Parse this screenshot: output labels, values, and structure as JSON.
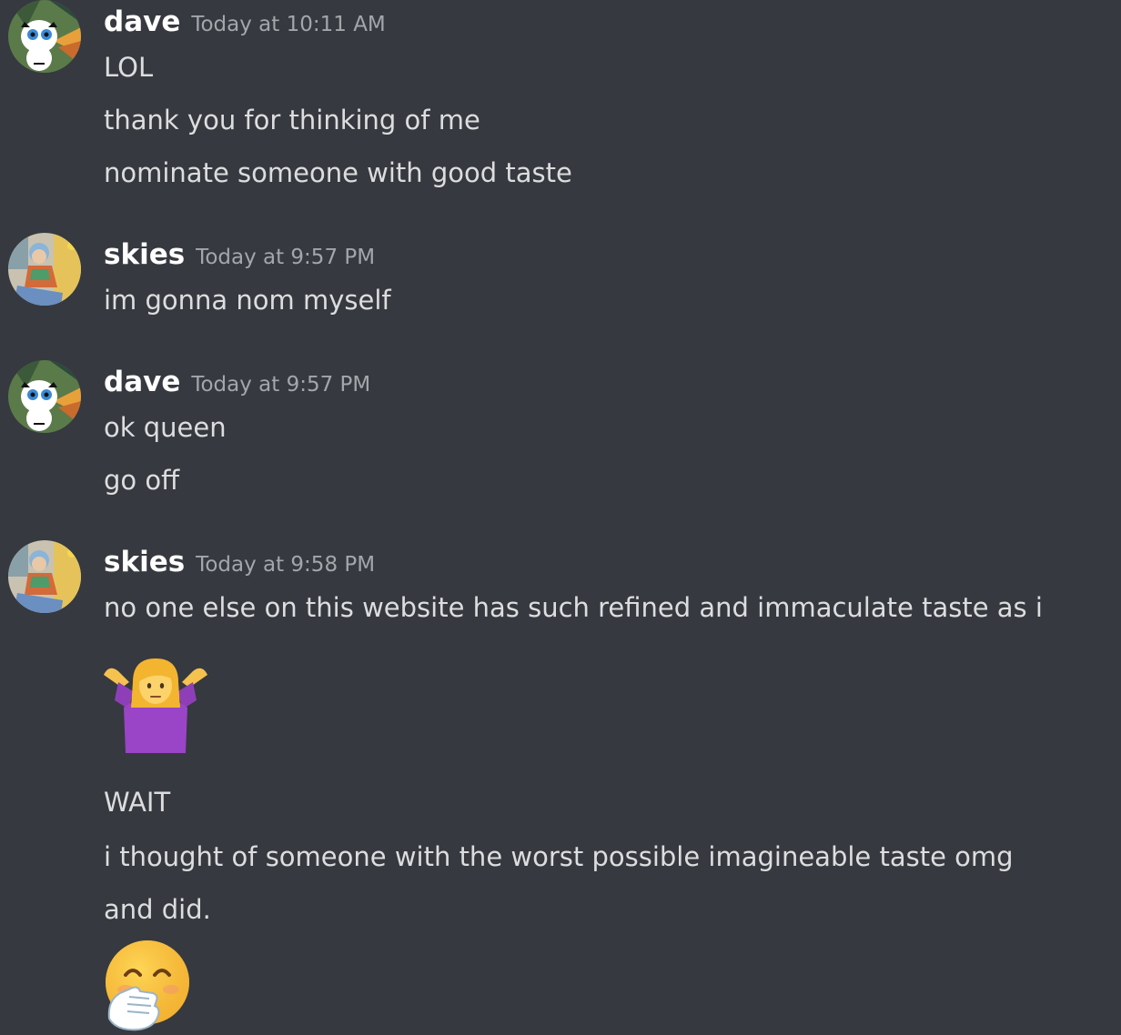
{
  "messages": [
    {
      "author": "dave",
      "time": "Today at 10:11 AM",
      "lines": [
        "LOL",
        "thank you for thinking of me",
        "nominate someone with good taste"
      ]
    },
    {
      "author": "skies",
      "time": "Today at 9:57 PM",
      "lines": [
        "im gonna nom myself"
      ]
    },
    {
      "author": "dave",
      "time": "Today at 9:57 PM",
      "lines": [
        "ok queen",
        "go off"
      ]
    },
    {
      "author": "skies",
      "time": "Today at 9:58 PM",
      "lines": [
        "no one else on this website has such refined and immaculate taste as i",
        "WAIT",
        "i thought of someone with the worst possible imagineable taste omg",
        "and did."
      ],
      "emojis": [
        "person-shrugging-emoji",
        "face-with-hand-over-mouth-emoji"
      ]
    }
  ],
  "colors": {
    "background": "#36393f",
    "username": "#ffffff",
    "timestamp": "#a3a6aa",
    "message_text": "#dcddde"
  }
}
